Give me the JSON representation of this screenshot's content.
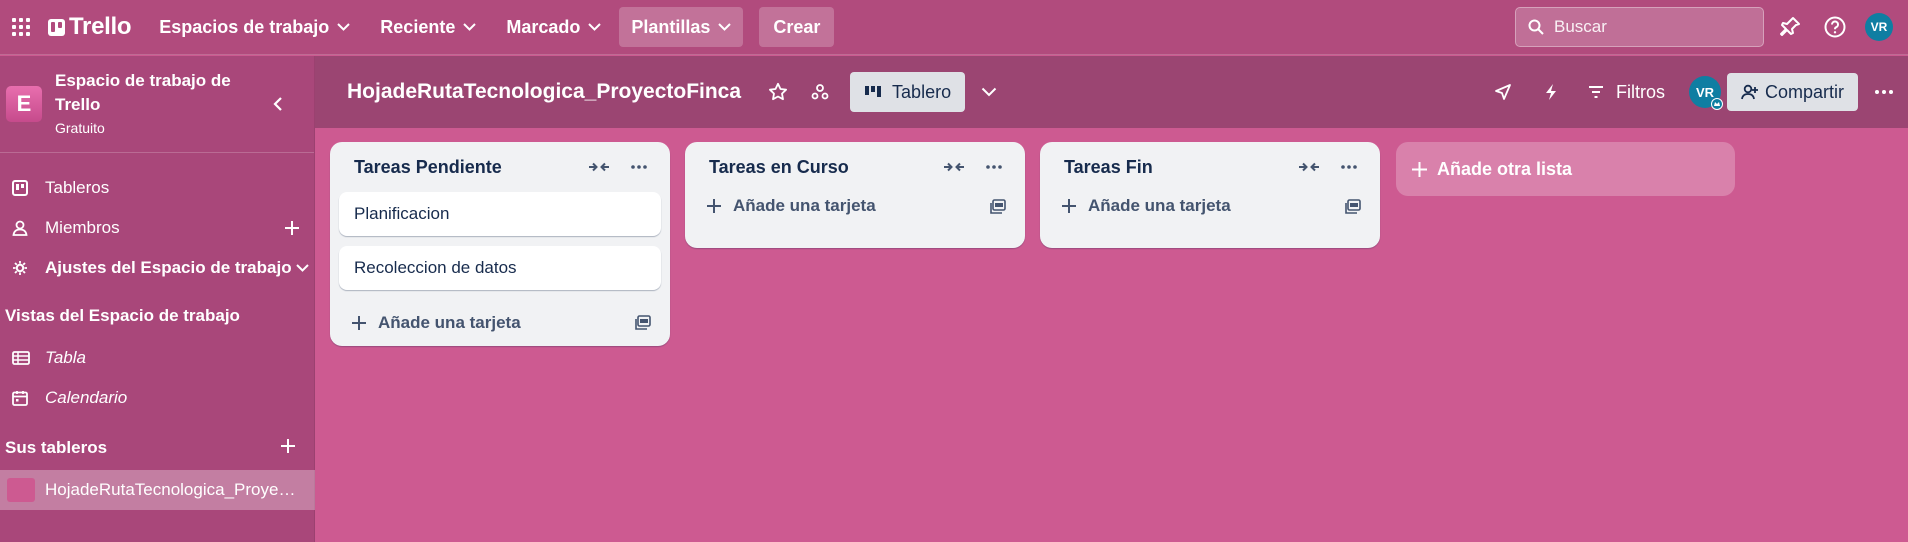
{
  "topnav": {
    "logo": "Trello",
    "menus": [
      {
        "label": "Espacios de trabajo"
      },
      {
        "label": "Reciente"
      },
      {
        "label": "Marcado"
      },
      {
        "label": "Plantillas"
      }
    ],
    "create_label": "Crear",
    "search_placeholder": "Buscar",
    "avatar_initials": "VR"
  },
  "sidebar": {
    "workspace_initial": "E",
    "workspace_name": "Espacio de trabajo de Trello",
    "workspace_plan": "Gratuito",
    "items": [
      {
        "label": "Tableros",
        "icon": "board-icon"
      },
      {
        "label": "Miembros",
        "icon": "person-icon"
      },
      {
        "label": "Ajustes del Espacio de trabajo",
        "icon": "gear-icon"
      }
    ],
    "views_heading": "Vistas del Espacio de trabajo",
    "views": [
      {
        "label": "Tabla",
        "icon": "table-icon"
      },
      {
        "label": "Calendario",
        "icon": "calendar-icon"
      }
    ],
    "boards_heading": "Sus tableros",
    "boards": [
      {
        "label": "HojadeRutaTecnologica_ProyectoFinca"
      }
    ]
  },
  "board": {
    "title": "HojadeRutaTecnologica_ProyectoFinca",
    "view_label": "Tablero",
    "filters_label": "Filtros",
    "share_label": "Compartir",
    "member_initials": "VR"
  },
  "lists": [
    {
      "title": "Tareas Pendiente",
      "cards": [
        "Planificacion",
        "Recoleccion de datos"
      ],
      "add_card_label": "Añade una tarjeta"
    },
    {
      "title": "Tareas en Curso",
      "cards": [],
      "add_card_label": "Añade una tarjeta"
    },
    {
      "title": "Tareas Fin",
      "cards": [],
      "add_card_label": "Añade una tarjeta"
    }
  ],
  "add_list_label": "Añade otra lista",
  "colors": {
    "board_background": "#cd5a91",
    "nav_background": "#b14b7d",
    "sidebar_background": "#a9477a",
    "header_background": "#9b4572",
    "list_background": "#f1f2f4",
    "avatar": "#0f7ea2"
  }
}
